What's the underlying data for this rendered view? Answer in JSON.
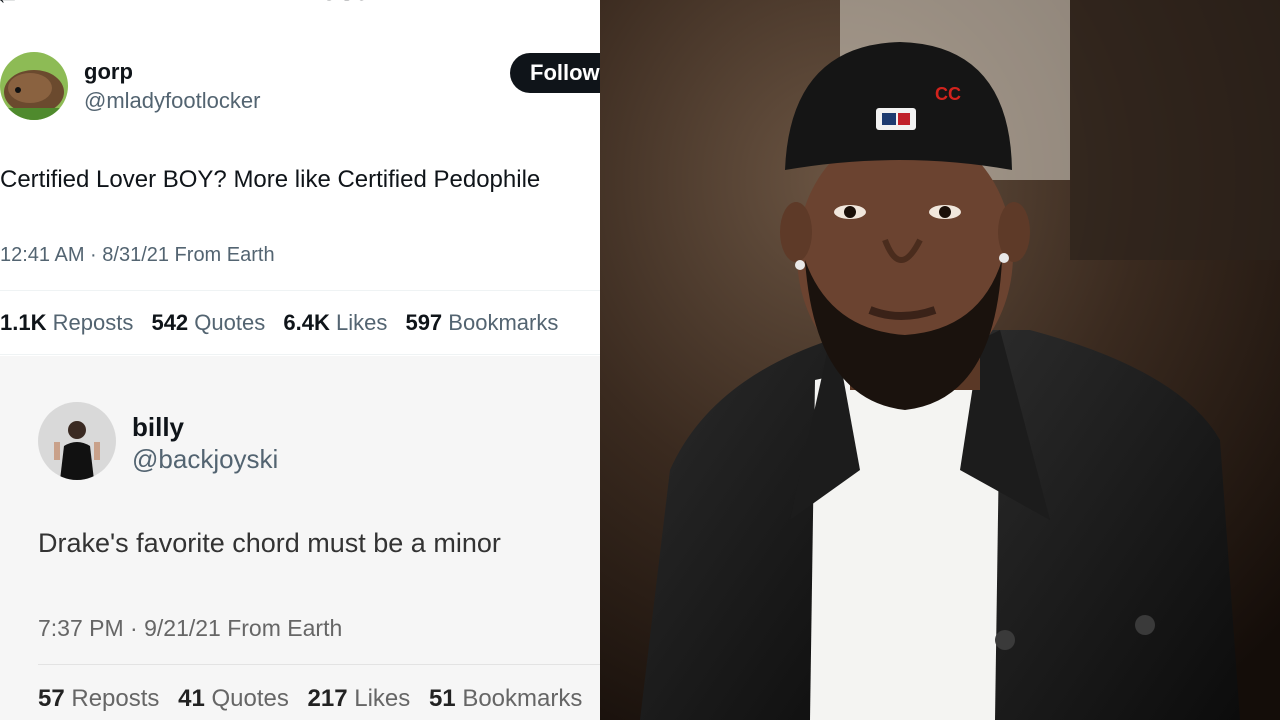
{
  "header": {
    "title": "Post"
  },
  "tweet1": {
    "name": "gorp",
    "handle": "@mladyfootlocker",
    "follow_label": "Follow",
    "text": "Certified Lover BOY? More like Certified Pedophile",
    "meta": "12:41 AM · 8/31/21 From Earth",
    "stats": {
      "reposts_count": "1.1K",
      "reposts_label": "Reposts",
      "quotes_count": "542",
      "quotes_label": "Quotes",
      "likes_count": "6.4K",
      "likes_label": "Likes",
      "bookmarks_count": "597",
      "bookmarks_label": "Bookmarks"
    }
  },
  "tweet2": {
    "name": "billy",
    "handle": "@backjoyski",
    "text": "Drake's favorite chord must be a minor",
    "meta": "7:37 PM · 9/21/21 From Earth",
    "stats": {
      "reposts_count": "57",
      "reposts_label": "Reposts",
      "quotes_count": "41",
      "quotes_label": "Quotes",
      "likes_count": "217",
      "likes_label": "Likes",
      "bookmarks_count": "51",
      "bookmarks_label": "Bookmarks"
    }
  },
  "photo": {
    "description_icon": "portrait-photo",
    "cap_logo_text": "CC"
  }
}
